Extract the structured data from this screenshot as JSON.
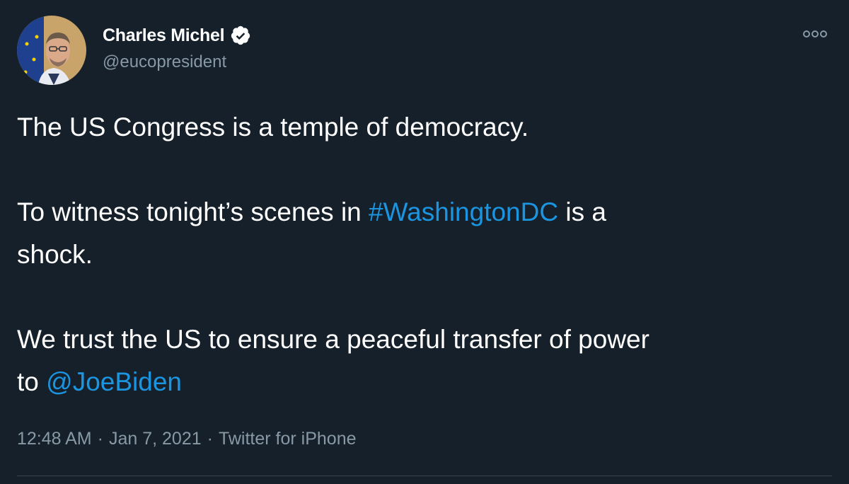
{
  "author": {
    "display_name": "Charles Michel",
    "handle": "@eucopresident",
    "verified": true,
    "avatar_icon": "avatar-photo"
  },
  "tweet": {
    "line1": "The US Congress is a temple of democracy.",
    "line2_pre": "To witness tonight’s scenes in ",
    "line2_hashtag": "#WashingtonDC",
    "line2_post": " is a",
    "line2_cont": "shock.",
    "line3": "We trust the US to ensure a peaceful transfer of power",
    "line4_pre": "to ",
    "line4_mention": "@JoeBiden"
  },
  "meta": {
    "time": "12:48 AM",
    "date": "Jan 7, 2021",
    "separator": "·",
    "source": "Twitter for iPhone"
  },
  "colors": {
    "background": "#15202b",
    "link": "#1b95e0",
    "secondary_text": "#8899a6",
    "divider": "#38444d"
  }
}
